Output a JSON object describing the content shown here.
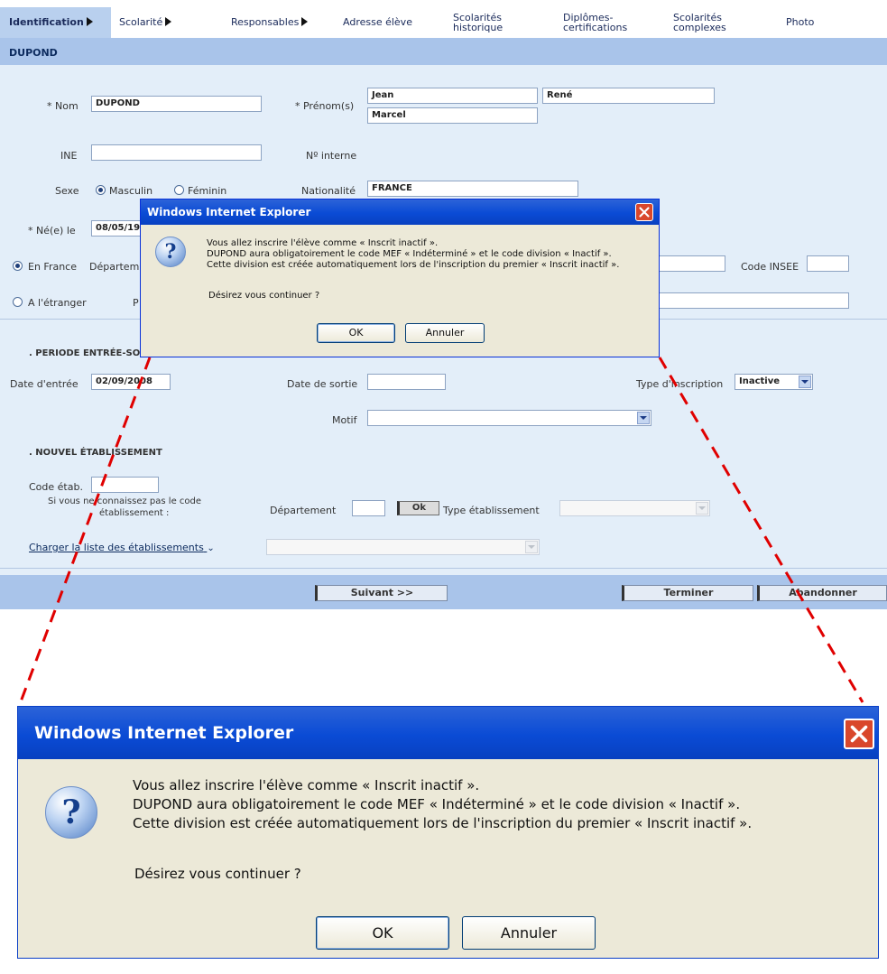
{
  "tabs": [
    {
      "label": "Identification",
      "arrow": true,
      "active": true
    },
    {
      "label": "Scolarité",
      "arrow": true,
      "active": false
    },
    {
      "label": "Responsables",
      "arrow": true,
      "active": false
    },
    {
      "label": "Adresse élève",
      "arrow": false,
      "active": false
    },
    {
      "line1": "Scolarités",
      "line2": "historique"
    },
    {
      "line1": "Diplômes-",
      "line2": "certifications"
    },
    {
      "line1": "Scolarités",
      "line2": "complexes"
    },
    {
      "label": "Photo"
    }
  ],
  "student_name": "DUPOND",
  "identity": {
    "nom_label": "* Nom",
    "nom_value": "DUPOND",
    "prenoms_label": "* Prénom(s)",
    "prenom1": "Jean",
    "prenom2": "René",
    "prenom3": "Marcel",
    "ine_label": "INE",
    "ine_value": "",
    "num_interne_label": "Nº interne",
    "sexe_label": "Sexe",
    "sexe_options": [
      "Masculin",
      "Féminin"
    ],
    "sexe_selected": "Masculin",
    "nationalite_label": "Nationalité",
    "nationalite_value": "FRANCE",
    "naissance_label": "* Né(e) le",
    "naissance_value": "08/05/19",
    "en_france_label": "En France",
    "departement_label": "Départem",
    "code_insee_label": "Code INSEE",
    "etranger_label": "A l'étranger",
    "etranger_partial": "P"
  },
  "periode": {
    "section_title": ". PERIODE ENTRÉE-SO",
    "date_entree_label": "Date d'entrée",
    "date_entree_value": "02/09/2008",
    "date_sortie_label": "Date de sortie",
    "type_inscription_label": "Type d'inscription",
    "type_inscription_value": "Inactive",
    "motif_label": "Motif"
  },
  "nouvel_etab": {
    "section_title": ". NOUVEL ÉTABLISSEMENT",
    "code_etab_label": "Code étab.",
    "hint_line1": "Si vous ne connaissez pas le code",
    "hint_line2": "établissement :",
    "departement_label": "Département",
    "ok_label": "Ok",
    "type_etab_label": "Type établissement",
    "charger_link": "Charger la liste des établissements"
  },
  "footer": {
    "suivant": "Suivant >>",
    "terminer": "Terminer",
    "abandonner": "Abandonner"
  },
  "dialog": {
    "title": "Windows Internet Explorer",
    "line1": "Vous allez inscrire l'élève comme « Inscrit inactif ».",
    "line2": "DUPOND  aura obligatoirement le code MEF « Indéterminé » et le code division « Inactif ».",
    "line3": "Cette division est créée automatiquement lors de l'inscription du premier « Inscrit inactif ».",
    "question": "Désirez vous continuer ?",
    "ok": "OK",
    "cancel": "Annuler"
  },
  "colors": {
    "form_bg": "#e3eef9",
    "bar_bg": "#a9c4ea",
    "dialog_title": "#0a4bd5",
    "dash": "#e00000"
  }
}
